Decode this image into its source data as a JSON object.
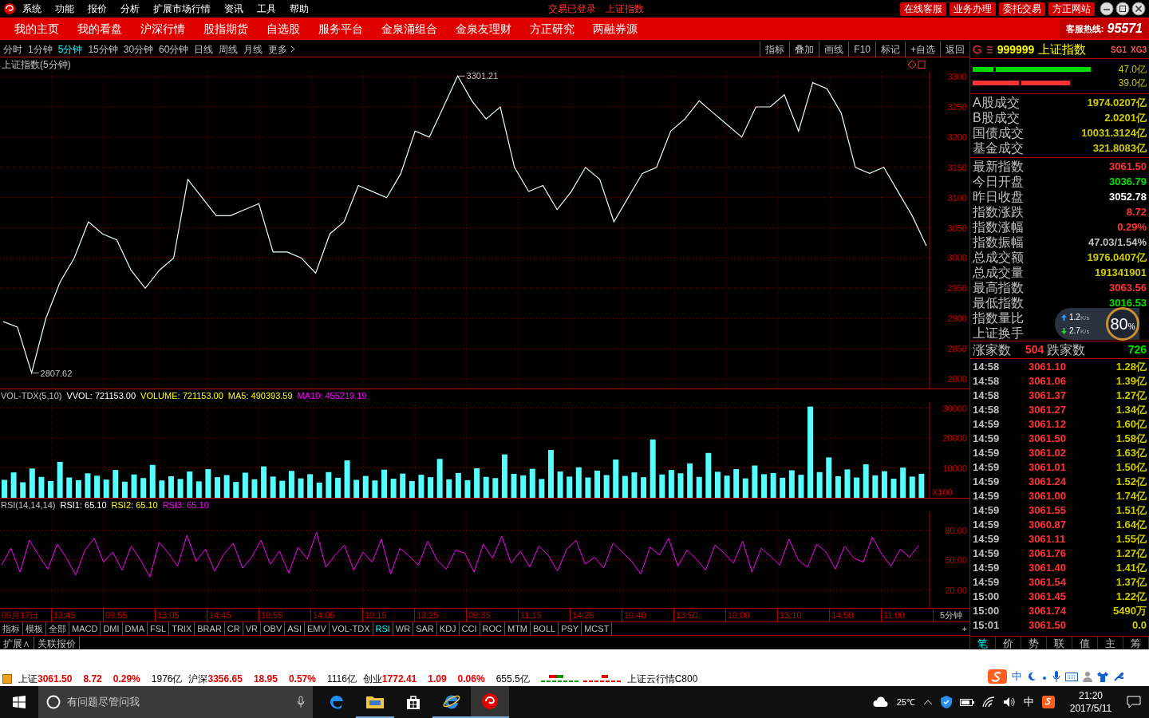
{
  "titlebar": {
    "menus": [
      "系统",
      "功能",
      "报价",
      "分析",
      "扩展市场行情",
      "资讯",
      "工具",
      "帮助"
    ],
    "status": [
      "交易已登录",
      "上证指数"
    ],
    "buttons": [
      "在线客服",
      "业务办理",
      "委托交易",
      "方正网站"
    ]
  },
  "nav": {
    "items": [
      "我的主页",
      "我的看盘",
      "沪深行情",
      "股指期货",
      "自选股",
      "服务平台",
      "金泉涌组合",
      "金泉友理财",
      "方正研究",
      "两融券源"
    ],
    "hotline_label": "客服热线:",
    "hotline": "95571"
  },
  "periods": [
    {
      "label": "分时",
      "selected": false
    },
    {
      "label": "1分钟",
      "selected": false
    },
    {
      "label": "5分钟",
      "selected": true
    },
    {
      "label": "15分钟",
      "selected": false
    },
    {
      "label": "30分钟",
      "selected": false
    },
    {
      "label": "60分钟",
      "selected": false
    },
    {
      "label": "日线",
      "selected": false
    },
    {
      "label": "周线",
      "selected": false
    },
    {
      "label": "月线",
      "selected": false
    },
    {
      "label": "更多",
      "selected": false
    }
  ],
  "tools": [
    "指标",
    "叠加",
    "画线",
    "F10",
    "标记",
    "+自选",
    "返回"
  ],
  "price_pane": {
    "title": "上证指数(5分钟)",
    "chart_data": {
      "type": "line",
      "grid": true,
      "ylim": [
        2783,
        3308
      ],
      "yticks": [
        2800,
        2850,
        2900,
        2950,
        3000,
        3050,
        3100,
        3150,
        3200,
        3250,
        3300
      ],
      "series": [
        {
          "color": "#e8ffff",
          "values": [
            2895,
            2886,
            2810,
            2900,
            2960,
            3000,
            3060,
            3040,
            3030,
            2980,
            2950,
            2980,
            3000,
            3130,
            3100,
            3070,
            3070,
            3080,
            3090,
            3010,
            3010,
            3000,
            2975,
            3040,
            3060,
            3120,
            3110,
            3100,
            3140,
            3210,
            3200,
            3250,
            3301,
            3260,
            3230,
            3250,
            3150,
            3110,
            3120,
            3080,
            3110,
            3150,
            3130,
            3060,
            3100,
            3140,
            3150,
            3210,
            3230,
            3260,
            3240,
            3220,
            3200,
            3250,
            3250,
            3270,
            3210,
            3290,
            3280,
            3240,
            3150,
            3140,
            3150,
            3110,
            3070,
            3020
          ]
        }
      ],
      "annotations": [
        {
          "text": "3301.21"
        },
        {
          "text": "2807.62"
        }
      ]
    }
  },
  "volume_pane": {
    "title": "VOL-TDX(5,10)",
    "readings": [
      {
        "text": "VVOL: 721153.00",
        "color": "#ffffff"
      },
      {
        "text": "VOLUME: 721153.00",
        "color": "#ffff00"
      },
      {
        "text": "MA5: 490393.59",
        "color": "#ffff00"
      },
      {
        "text": "MA10: 455219.19",
        "color": "#ff00ff"
      }
    ],
    "unit": "X100",
    "chart_data": {
      "type": "bar",
      "grid": true,
      "ylim": [
        0,
        32000
      ],
      "yticks": [
        10000,
        20000,
        30000
      ],
      "series": [
        {
          "color": "#55ffff",
          "values": [
            6000,
            8500,
            5200,
            9800,
            7000,
            5600,
            12000,
            6800,
            5900,
            8200,
            7400,
            6100,
            9300,
            5400,
            7800,
            6600,
            11000,
            5800,
            7200,
            6300,
            8800,
            5500,
            9600,
            6900,
            7600,
            5300,
            8400,
            6200,
            10500,
            7100,
            5700,
            9000,
            6500,
            7900,
            5100,
            8600,
            6700,
            12500,
            6000,
            7300,
            5800,
            9400,
            6400,
            8100,
            5600,
            7700,
            6900,
            13000,
            6200,
            8300,
            5900,
            9900,
            7000,
            6600,
            14500,
            8000,
            7500,
            9700,
            6300,
            16000,
            8800,
            7100,
            10200,
            6800,
            9100,
            7600,
            12800,
            7300,
            8500,
            6900,
            19500,
            7800,
            9300,
            8200,
            11500,
            7000,
            15000,
            8700,
            7400,
            9600,
            6500,
            10800,
            7900,
            8300,
            6700,
            9200,
            7700,
            30500,
            8600,
            13500,
            7200,
            9500,
            6800,
            11200,
            7500,
            8900,
            6400,
            10100,
            7100,
            8000
          ]
        }
      ]
    }
  },
  "rsi_pane": {
    "title": "RSI(14,14,14)",
    "readings": [
      {
        "text": "RSI1: 65.10",
        "color": "#ffffff"
      },
      {
        "text": "RSI2: 65.10",
        "color": "#ffff00"
      },
      {
        "text": "RSI3: 65.10",
        "color": "#ff00ff"
      }
    ],
    "chart_data": {
      "type": "line",
      "grid": true,
      "ylim": [
        2,
        99
      ],
      "yticks": [
        {
          "value": 80,
          "label": "80.00"
        },
        {
          "value": 50,
          "label": "50.00"
        },
        {
          "value": 20,
          "label": "20.00"
        }
      ],
      "series": [
        {
          "color": "#ff00ff",
          "values": [
            45,
            62,
            38,
            70,
            55,
            41,
            66,
            52,
            35,
            60,
            72,
            48,
            58,
            40,
            64,
            50,
            33,
            68,
            57,
            44,
            75,
            49,
            61,
            39,
            56,
            67,
            42,
            53,
            70,
            46,
            59,
            37,
            63,
            51,
            78,
            43,
            55,
            65,
            40,
            58,
            48,
            71,
            36,
            62,
            54,
            45,
            69,
            50,
            41,
            60,
            57,
            38,
            66,
            52,
            74,
            47,
            59,
            43,
            64,
            55,
            39,
            61,
            70,
            46,
            53,
            42,
            67,
            58,
            49,
            36,
            63,
            55,
            72,
            44,
            60,
            51,
            40,
            65,
            57,
            47,
            69,
            38,
            62,
            54,
            45,
            71,
            50,
            43,
            66,
            58,
            41,
            64,
            52,
            48,
            73,
            56,
            44,
            61,
            53,
            65
          ]
        }
      ]
    }
  },
  "x_axis": {
    "labels": [
      "06月17日",
      "13:45",
      "09:55",
      "13:05",
      "14:45",
      "10:55",
      "14:05",
      "10:15",
      "13:25",
      "09:35",
      "11:15",
      "14:25",
      "10:40",
      "13:50",
      "10:00",
      "13:10",
      "14:50",
      "11:00"
    ],
    "period": "5分钟"
  },
  "indicator_tabs": [
    {
      "label": "指标",
      "selected": false
    },
    {
      "label": "模板",
      "selected": false
    },
    {
      "label": "全部",
      "selected": false
    },
    {
      "label": "MACD",
      "selected": false
    },
    {
      "label": "DMI",
      "selected": false
    },
    {
      "label": "DMA",
      "selected": false
    },
    {
      "label": "FSL",
      "selected": false
    },
    {
      "label": "TRIX",
      "selected": false
    },
    {
      "label": "BRAR",
      "selected": false
    },
    {
      "label": "CR",
      "selected": false
    },
    {
      "label": "VR",
      "selected": false
    },
    {
      "label": "OBV",
      "selected": false
    },
    {
      "label": "ASI",
      "selected": false
    },
    {
      "label": "EMV",
      "selected": false
    },
    {
      "label": "VOL-TDX",
      "selected": false
    },
    {
      "label": "RSI",
      "selected": true
    },
    {
      "label": "WR",
      "selected": false
    },
    {
      "label": "SAR",
      "selected": false
    },
    {
      "label": "KDJ",
      "selected": false
    },
    {
      "label": "CCI",
      "selected": false
    },
    {
      "label": "ROC",
      "selected": false
    },
    {
      "label": "MTM",
      "selected": false
    },
    {
      "label": "BOLL",
      "selected": false
    },
    {
      "label": "PSY",
      "selected": false
    },
    {
      "label": "MCST",
      "selected": false
    }
  ],
  "indicator_add": "+",
  "extension_tabs": [
    "扩展∧",
    "关联报价"
  ],
  "quote_panel": {
    "prefix": "G",
    "code": "999999",
    "name": "上证指数",
    "signals": [
      "SG1",
      "XG3"
    ],
    "flow_bars": [
      {
        "color": "#00dd00",
        "reading": "47.0亿"
      },
      {
        "color": "#ff3333",
        "reading": "39.0亿"
      }
    ],
    "turnover": [
      {
        "label": "A股成交",
        "value": "1974.0207亿"
      },
      {
        "label": "B股成交",
        "value": "2.0201亿"
      },
      {
        "label": "国债成交",
        "value": "10031.3124亿"
      },
      {
        "label": "基金成交",
        "value": "321.8083亿"
      }
    ],
    "stats": [
      {
        "label": "最新指数",
        "value": "3061.50",
        "color": "#ff3333"
      },
      {
        "label": "今日开盘",
        "value": "3036.79",
        "color": "#00e000"
      },
      {
        "label": "昨日收盘",
        "value": "3052.78",
        "color": "#ffffff"
      },
      {
        "label": "指数涨跌",
        "value": "8.72",
        "color": "#ff3333"
      },
      {
        "label": "指数涨幅",
        "value": "0.29%",
        "color": "#ff3333"
      },
      {
        "label": "指数振幅",
        "value": "47.03/1.54%",
        "color": "#c0c0c0"
      },
      {
        "label": "总成交额",
        "value": "1976.0407亿",
        "color": "#cccc00"
      },
      {
        "label": "总成交量",
        "value": "191341901",
        "color": "#cccc00"
      },
      {
        "label": "最高指数",
        "value": "3063.56",
        "color": "#ff3333"
      },
      {
        "label": "最低指数",
        "value": "3016.53",
        "color": "#00e000"
      },
      {
        "label": "指数量比"
      },
      {
        "label": "上证换手"
      }
    ],
    "breadth": {
      "up_label": "涨家数",
      "up": "504",
      "down_label": "跌家数",
      "down": "726"
    },
    "ticks": [
      {
        "time": "14:58",
        "price": "3061.10",
        "volume": "1.28亿"
      },
      {
        "time": "14:58",
        "price": "3061.06",
        "volume": "1.39亿"
      },
      {
        "time": "14:58",
        "price": "3061.37",
        "volume": "1.27亿"
      },
      {
        "time": "14:58",
        "price": "3061.27",
        "volume": "1.34亿"
      },
      {
        "time": "14:59",
        "price": "3061.12",
        "volume": "1.60亿"
      },
      {
        "time": "14:59",
        "price": "3061.50",
        "volume": "1.58亿"
      },
      {
        "time": "14:59",
        "price": "3061.02",
        "volume": "1.63亿"
      },
      {
        "time": "14:59",
        "price": "3061.01",
        "volume": "1.50亿"
      },
      {
        "time": "14:59",
        "price": "3061.24",
        "volume": "1.52亿"
      },
      {
        "time": "14:59",
        "price": "3061.00",
        "volume": "1.74亿"
      },
      {
        "time": "14:59",
        "price": "3061.55",
        "volume": "1.51亿"
      },
      {
        "time": "14:59",
        "price": "3060.87",
        "volume": "1.64亿"
      },
      {
        "time": "14:59",
        "price": "3061.11",
        "volume": "1.55亿"
      },
      {
        "time": "14:59",
        "price": "3061.76",
        "volume": "1.27亿"
      },
      {
        "time": "14:59",
        "price": "3061.40",
        "volume": "1.41亿"
      },
      {
        "time": "14:59",
        "price": "3061.54",
        "volume": "1.37亿"
      },
      {
        "time": "15:00",
        "price": "3061.45",
        "volume": "1.22亿"
      },
      {
        "time": "15:00",
        "price": "3061.74",
        "volume": "5490万"
      },
      {
        "time": "15:01",
        "price": "3061.50",
        "volume": "0.0"
      }
    ],
    "tabs": [
      {
        "label": "笔",
        "selected": true
      },
      {
        "label": "价",
        "selected": false
      },
      {
        "label": "势",
        "selected": false
      },
      {
        "label": "联",
        "selected": false
      },
      {
        "label": "值",
        "selected": false
      },
      {
        "label": "主",
        "selected": false
      },
      {
        "label": "筹",
        "selected": false
      }
    ]
  },
  "speed_widget": {
    "up": "1.2",
    "up_unit": "K/s",
    "down": "2.7",
    "down_unit": "K/s",
    "load": "80",
    "percent": "%"
  },
  "status_bar": {
    "indices": [
      {
        "name": "上证",
        "price": "3061.50",
        "change": "8.72",
        "pct": "0.29%",
        "amount": "1976亿"
      },
      {
        "name": "沪深",
        "price": "3356.65",
        "change": "18.95",
        "pct": "0.57%",
        "amount": "1116亿"
      },
      {
        "name": "创业",
        "price": "1772.41",
        "change": "1.09",
        "pct": "0.06%",
        "amount": "655.5亿"
      }
    ],
    "feed": "上证云行情C800"
  },
  "ime_toolbar": {
    "mode": "中"
  },
  "taskbar": {
    "search_placeholder": "有问题尽管问我",
    "weather": "25℃",
    "ime": "中",
    "time": "21:20",
    "date": "2017/5/11"
  }
}
